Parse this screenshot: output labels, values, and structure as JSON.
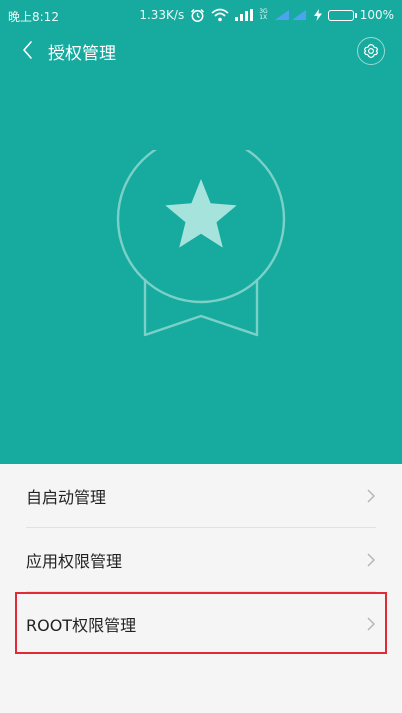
{
  "status_bar": {
    "time": "晚上8:12",
    "speed": "1.33K/s",
    "net_3g": "3G",
    "net_1x": "1X",
    "battery": "100%"
  },
  "header": {
    "title": "授权管理"
  },
  "list": {
    "items": [
      {
        "label": "自启动管理"
      },
      {
        "label": "应用权限管理"
      },
      {
        "label": "ROOT权限管理"
      }
    ]
  },
  "colors": {
    "header_bg": "#17aba0",
    "badge_star": "#a6e3dc",
    "highlight_border": "#e02b36",
    "battery_fill": "#3ff06a"
  },
  "icons": {
    "back": "chevron-left-icon",
    "settings": "gear-icon",
    "badge": "award-badge-icon",
    "alarm": "alarm-clock-icon",
    "wifi": "wifi-icon",
    "signal": "signal-icon",
    "charging": "lightning-icon",
    "row_chevron": "chevron-right-icon"
  }
}
